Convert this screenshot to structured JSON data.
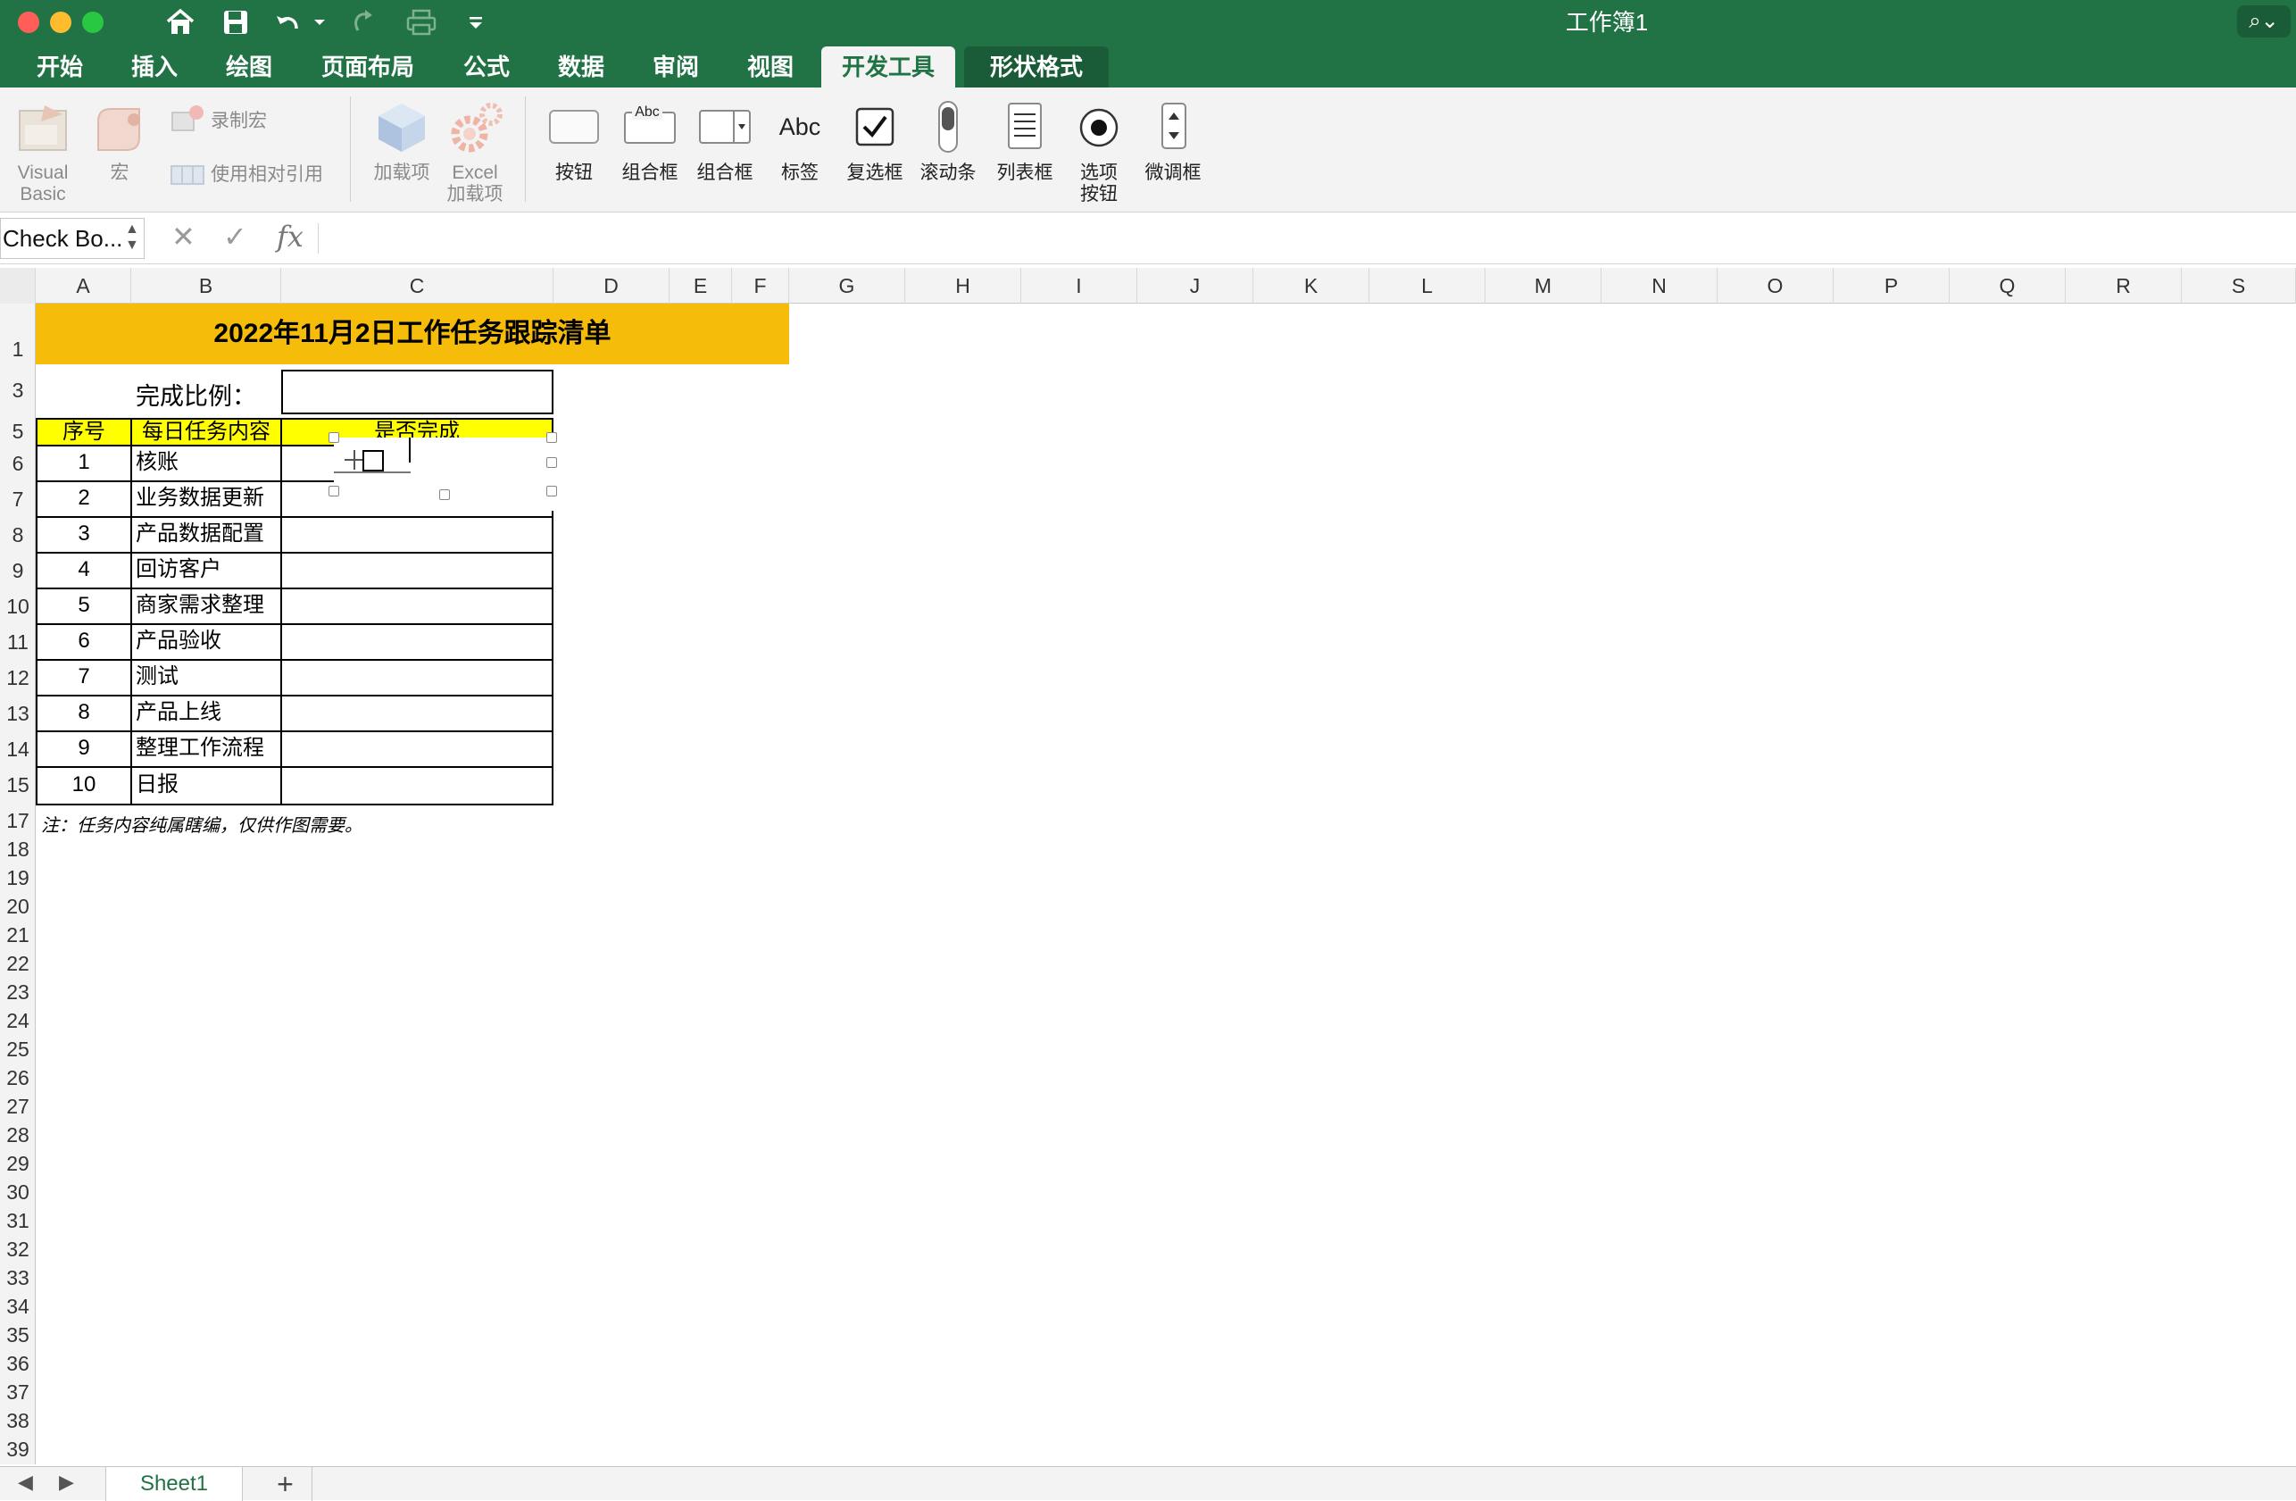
{
  "window": {
    "title": "工作簿1"
  },
  "tabs": [
    {
      "label": "开始"
    },
    {
      "label": "插入"
    },
    {
      "label": "绘图"
    },
    {
      "label": "页面布局"
    },
    {
      "label": "公式"
    },
    {
      "label": "数据"
    },
    {
      "label": "审阅"
    },
    {
      "label": "视图"
    },
    {
      "label": "开发工具"
    },
    {
      "label": "形状格式"
    }
  ],
  "ribbon": {
    "visual_basic": {
      "line1": "Visual",
      "line2": "Basic"
    },
    "macro": "宏",
    "record_macro": "录制宏",
    "relative_ref": "使用相对引用",
    "addins": "加载项",
    "excel_addins": {
      "line1": "Excel",
      "line2": "加载项"
    },
    "controls": [
      {
        "label": "按钮",
        "icon": "button-control-icon"
      },
      {
        "label": "组合框",
        "icon": "group-box-icon",
        "caption": "Abc"
      },
      {
        "label": "组合框",
        "icon": "combo-box-icon"
      },
      {
        "label": "标签",
        "icon": "label-control-icon",
        "caption": "Abc"
      },
      {
        "label": "复选框",
        "icon": "checkbox-control-icon"
      },
      {
        "label": "滚动条",
        "icon": "scrollbar-control-icon"
      },
      {
        "label": "列表框",
        "icon": "listbox-control-icon"
      },
      {
        "label": "选项",
        "label2": "按钮",
        "icon": "option-button-icon"
      },
      {
        "label": "微调框",
        "icon": "spinner-control-icon"
      }
    ]
  },
  "formula_bar": {
    "name_box": "Check Bo...",
    "fx": "fx"
  },
  "columns": [
    "A",
    "B",
    "C",
    "D",
    "E",
    "F",
    "G",
    "H",
    "I",
    "J",
    "K",
    "L",
    "M",
    "N",
    "O",
    "P",
    "Q",
    "R",
    "S"
  ],
  "rows": [
    "1",
    "3",
    "5",
    "6",
    "7",
    "8",
    "9",
    "10",
    "11",
    "12",
    "13",
    "14",
    "15",
    "17",
    "18",
    "19",
    "20",
    "21",
    "22",
    "23",
    "24",
    "25",
    "26",
    "27",
    "28",
    "29",
    "30",
    "31",
    "32",
    "33",
    "34",
    "35",
    "36",
    "37",
    "38",
    "39"
  ],
  "sheet": {
    "title": "2022年11月2日工作任务跟踪清单",
    "ratio_label": "完成比例：",
    "headers": {
      "seq": "序号",
      "task": "每日任务内容",
      "done": "是否完成"
    },
    "tasks": [
      {
        "seq": "1",
        "task": "核账"
      },
      {
        "seq": "2",
        "task": "业务数据更新"
      },
      {
        "seq": "3",
        "task": "产品数据配置"
      },
      {
        "seq": "4",
        "task": "回访客户"
      },
      {
        "seq": "5",
        "task": "商家需求整理"
      },
      {
        "seq": "6",
        "task": "产品验收"
      },
      {
        "seq": "7",
        "task": "测试"
      },
      {
        "seq": "8",
        "task": "产品上线"
      },
      {
        "seq": "9",
        "task": "整理工作流程"
      },
      {
        "seq": "10",
        "task": "日报"
      }
    ],
    "note": "注：任务内容纯属瞎编，仅供作图需要。"
  },
  "bottom": {
    "sheet_tab": "Sheet1",
    "add": "+"
  }
}
